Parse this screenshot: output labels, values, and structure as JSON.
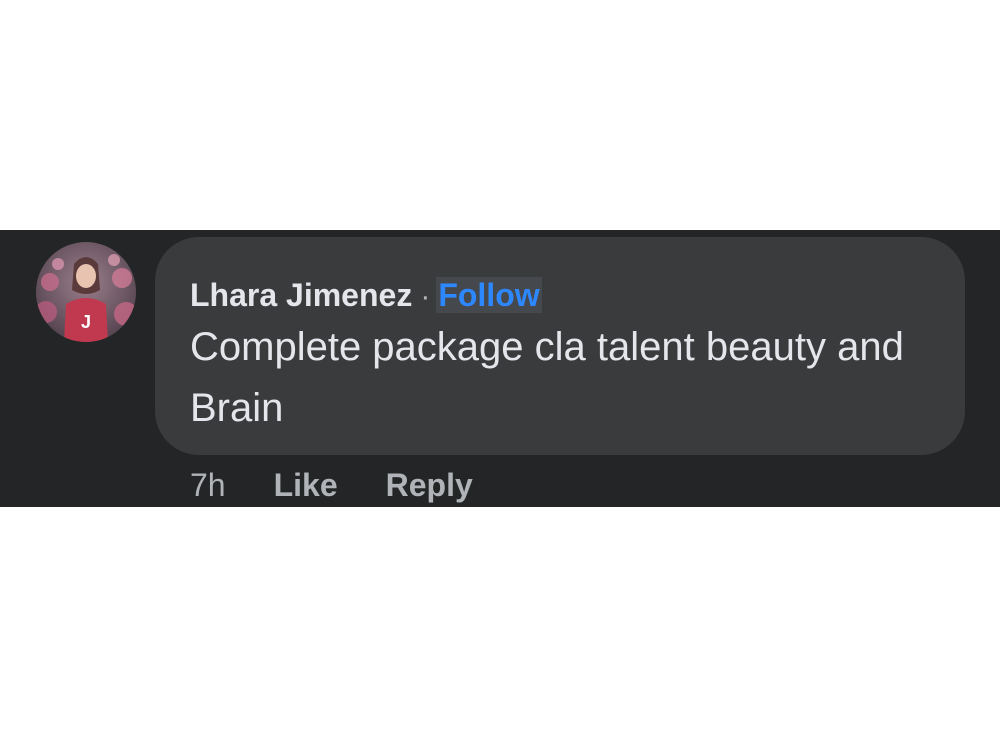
{
  "comment": {
    "author": "Lhara Jimenez",
    "separator": "·",
    "follow_label": "Follow",
    "text": "Complete package cla talent beauty and Brain",
    "timestamp": "7h",
    "like_label": "Like",
    "reply_label": "Reply"
  },
  "avatar": {
    "icon": "user-avatar-icon",
    "letter": "J"
  },
  "colors": {
    "background": "#242526",
    "bubble": "#3a3b3c",
    "primary_text": "#e4e6eb",
    "secondary_text": "#b0b3b8",
    "link": "#2d88ff"
  }
}
